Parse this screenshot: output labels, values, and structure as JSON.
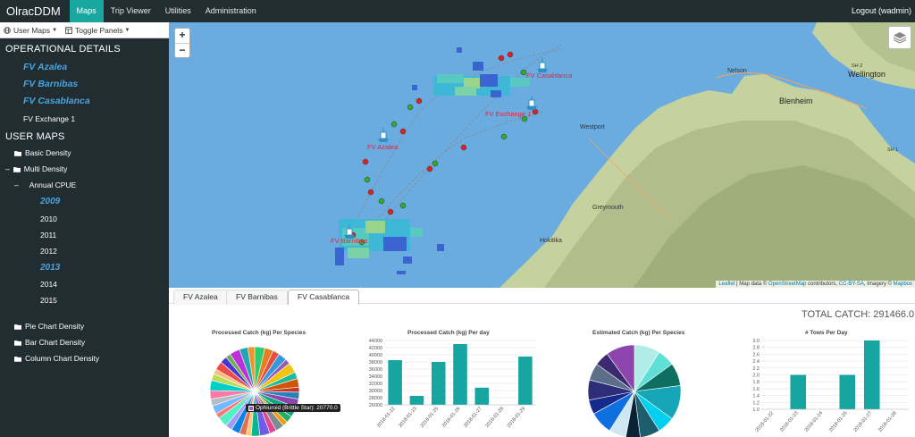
{
  "navbar": {
    "brand": "OlracDDM",
    "items": [
      "Maps",
      "Trip Viewer",
      "Utilities",
      "Administration"
    ],
    "active": "Maps",
    "logout": "Logout (wadmin)"
  },
  "sidebar": {
    "toolbar": {
      "user_maps": "User Maps",
      "toggle_panels": "Toggle Panels"
    },
    "operational_header": "OPERATIONAL DETAILS",
    "vessels": [
      "FV Azalea",
      "FV Barnibas",
      "FV Casablanca"
    ],
    "exchange": "FV Exchange 1",
    "user_maps_header": "USER MAPS",
    "folders": {
      "basic": "Basic Density",
      "multi": "Multi Density",
      "annual": "Annual CPUE",
      "pie": "Pie Chart Density",
      "bar": "Bar Chart Density",
      "column": "Column Chart Density"
    },
    "years": [
      "2009",
      "2010",
      "2011",
      "2012",
      "2013",
      "2014",
      "2015"
    ],
    "highlighted_years": [
      "2009",
      "2013"
    ]
  },
  "map": {
    "zoom_in": "+",
    "zoom_out": "−",
    "places": {
      "nelson": "Nelson",
      "wellington": "Wellington",
      "blenheim": "Blenheim",
      "westport": "Westport",
      "greymouth": "Greymouth",
      "hokitika": "Hokitika",
      "road_sh2": "SH 2",
      "road_sh1": "SH 1"
    },
    "vessel_labels": {
      "casablanca": "FV Casablanca",
      "exchange": "FV Exchange 1",
      "azalea": "FV Azalea",
      "barnibas": "FV Barnibas"
    },
    "attribution": {
      "leaflet": "Leaflet",
      "map_data": "| Map data ©",
      "osm": "OpenStreetMap",
      "contrib": "contributors,",
      "ccbysa": "CC-BY-SA",
      "imagery": ", Imagery ©",
      "mapbox": "Mapbox"
    },
    "colors": {
      "sea": "#6aace0",
      "land": "#c9d4a6",
      "track": "#888888",
      "label": "#e4233a"
    }
  },
  "tabs": [
    "FV Azalea",
    "FV Barnibas",
    "FV Casablanca"
  ],
  "active_tab": "FV Casablanca",
  "total_catch": "TOTAL CATCH: 291466.0 Kg",
  "tooltip": "Ophiuroid (Brittle Star): 20770.0",
  "chart_data": [
    {
      "type": "pie",
      "title": "Processed Catch (kg) Per Species",
      "values": [
        6,
        5,
        4,
        5,
        3,
        6,
        4,
        5,
        3,
        4,
        5,
        6,
        4,
        3,
        5,
        4,
        6,
        5,
        3,
        4,
        5,
        4,
        6,
        3,
        5,
        4,
        5,
        6,
        4,
        3,
        5,
        4,
        3,
        6,
        5,
        4
      ],
      "colors": [
        "#2ecc71",
        "#e67e22",
        "#e74c3c",
        "#3498db",
        "#9b59b6",
        "#f1c40f",
        "#1abc9c",
        "#d35400",
        "#c0392b",
        "#2980b9",
        "#8e44ad",
        "#16a085",
        "#27ae60",
        "#f39c12",
        "#7f8c8d",
        "#e84393",
        "#6c5ce7",
        "#00b894",
        "#fdcb6e",
        "#e17055",
        "#0984e3",
        "#a29bfe",
        "#55efc4",
        "#ff7675",
        "#74b9ff",
        "#b2bec3",
        "#fd79a8",
        "#00cec9",
        "#badc58",
        "#ffbe76",
        "#eb4d4b",
        "#4834d4",
        "#6ab04c",
        "#be2edd",
        "#22a6b3",
        "#f0932b"
      ]
    },
    {
      "type": "bar",
      "title": "Processed Catch (kg) Per day",
      "categories": [
        "2018-01-22",
        "2018-01-23",
        "2018-01-25",
        "2018-01-26",
        "2018-01-27",
        "2018-01-28",
        "2018-01-29"
      ],
      "values": [
        38500,
        28500,
        38000,
        43000,
        30800,
        0,
        39500
      ],
      "yticks": [
        26000,
        28000,
        30000,
        32000,
        34000,
        36000,
        38000,
        40000,
        42000,
        44000
      ],
      "ylim": [
        26000,
        44000
      ],
      "color": "#16a5a0"
    },
    {
      "type": "pie",
      "title": "Estimated Catch (kg) Per Species",
      "values": [
        9,
        6,
        8,
        12,
        6,
        7,
        5,
        6,
        8,
        5,
        7,
        6,
        5,
        10
      ],
      "colors": [
        "#b2ece6",
        "#5ee0d8",
        "#0e6f61",
        "#17a6b8",
        "#00d0f0",
        "#1d5d6e",
        "#0a2233",
        "#cfe6f3",
        "#0e6fe0",
        "#152a8a",
        "#2d2d7a",
        "#5c6e8a",
        "#3b2a70",
        "#8e44ad"
      ]
    },
    {
      "type": "bar",
      "title": "# Tows Per Day",
      "categories": [
        "2018-01-22",
        "2018-01-23",
        "2018-01-24",
        "2018-01-25",
        "2018-01-27",
        "2018-01-28"
      ],
      "values": [
        0,
        2,
        0,
        2,
        3,
        0
      ],
      "yticks": [
        1.0,
        1.2,
        1.4,
        1.6,
        1.8,
        2.0,
        2.2,
        2.4,
        2.6,
        2.8,
        3.0
      ],
      "ylim": [
        1.0,
        3.0
      ],
      "color": "#16a5a0"
    }
  ]
}
